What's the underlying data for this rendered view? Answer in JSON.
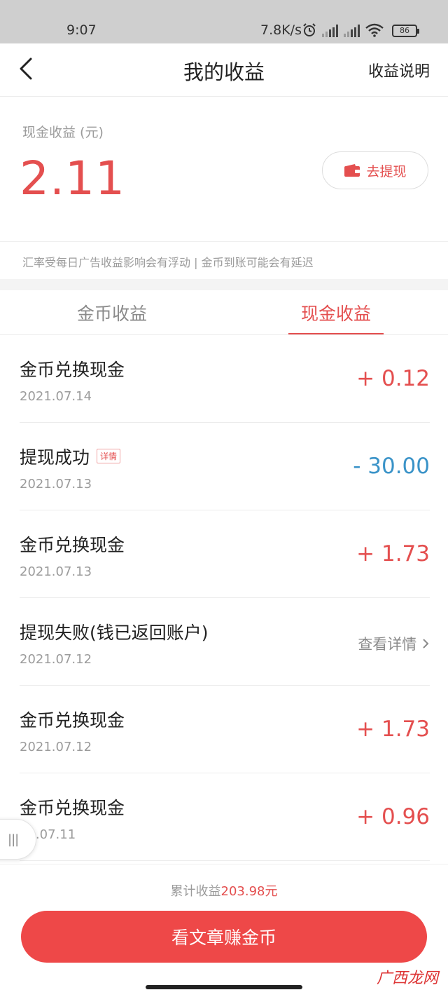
{
  "status_bar": {
    "time": "9:07",
    "net_speed": "7.8K/s",
    "battery": "86"
  },
  "nav": {
    "title": "我的收益",
    "right_link": "收益说明"
  },
  "balance": {
    "label": "现金收益 (元)",
    "value": "2.11",
    "withdraw_label": "去提现"
  },
  "notice": "汇率受每日广告收益影响会有浮动 | 金币到账可能会有延迟",
  "tabs": [
    {
      "label": "金币收益",
      "active": false
    },
    {
      "label": "现金收益",
      "active": true
    }
  ],
  "records": [
    {
      "title": "金币兑换现金",
      "date": "2021.07.14",
      "amount": "+ 0.12"
    },
    {
      "title": "提现成功",
      "tag": "详情",
      "date": "2021.07.13",
      "amount": "- 30.00"
    },
    {
      "title": "金币兑换现金",
      "date": "2021.07.13",
      "amount": "+ 1.73"
    },
    {
      "title": "提现失败(钱已返回账户)",
      "date": "2021.07.12",
      "link": "查看详情"
    },
    {
      "title": "金币兑换现金",
      "date": "2021.07.12",
      "amount": "+ 1.73"
    },
    {
      "title": "金币兑换现金",
      "date": "21.07.11",
      "amount": "+ 0.96"
    }
  ],
  "footer": {
    "total_prefix": "累计收益",
    "total_value": "203.98元",
    "cta_label": "看文章赚金币"
  },
  "watermark": "广西龙网",
  "colors": {
    "accent_red": "#e44f4f",
    "button_red": "#ee4848",
    "negative_blue": "#3a93c8"
  }
}
